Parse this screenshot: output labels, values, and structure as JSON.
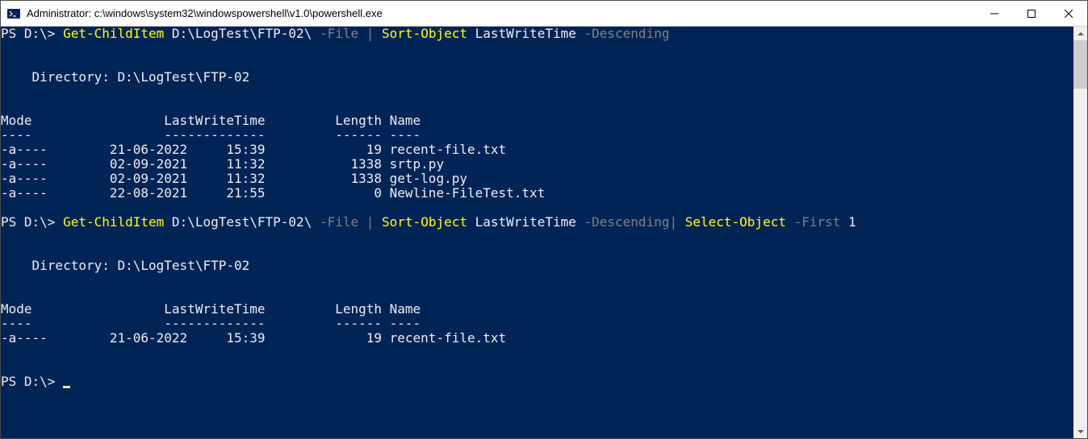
{
  "window": {
    "title": "Administrator: c:\\windows\\system32\\windowspowershell\\v1.0\\powershell.exe"
  },
  "terminal": {
    "prompt1": "PS D:\\> ",
    "cmd1": {
      "cmdlet1": "Get-ChildItem",
      "arg1": " D:\\LogTest\\FTP-02\\ ",
      "param1": "-File",
      "pipe1": " | ",
      "cmdlet2": "Sort-Object",
      "arg2": " LastWriteTime ",
      "param2": "-Descending"
    },
    "blank1": "",
    "blank2": "",
    "dir1": "    Directory: D:\\LogTest\\FTP-02",
    "blank3": "",
    "blank4": "",
    "header1": "Mode                 LastWriteTime         Length Name",
    "divider1": "----                 -------------         ------ ----",
    "row1": "-a----        21-06-2022     15:39             19 recent-file.txt",
    "row2": "-a----        02-09-2021     11:32           1338 srtp.py",
    "row3": "-a----        02-09-2021     11:32           1338 get-log.py",
    "row4": "-a----        22-08-2021     21:55              0 Newline-FileTest.txt",
    "blank5": "",
    "prompt2": "PS D:\\> ",
    "cmd2": {
      "cmdlet1": "Get-ChildItem",
      "arg1": " D:\\LogTest\\FTP-02\\ ",
      "param1": "-File",
      "pipe1": " | ",
      "cmdlet2": "Sort-Object",
      "arg2": " LastWriteTime ",
      "param2": "-Descending",
      "pipe2": "| ",
      "cmdlet3": "Select-Object",
      "space3": " ",
      "param3": "-First",
      "arg3": " 1"
    },
    "blank6": "",
    "blank7": "",
    "dir2": "    Directory: D:\\LogTest\\FTP-02",
    "blank8": "",
    "blank9": "",
    "header2": "Mode                 LastWriteTime         Length Name",
    "divider2": "----                 -------------         ------ ----",
    "row5": "-a----        21-06-2022     15:39             19 recent-file.txt",
    "blank10": "",
    "blank11": "",
    "prompt3": "PS D:\\> "
  }
}
